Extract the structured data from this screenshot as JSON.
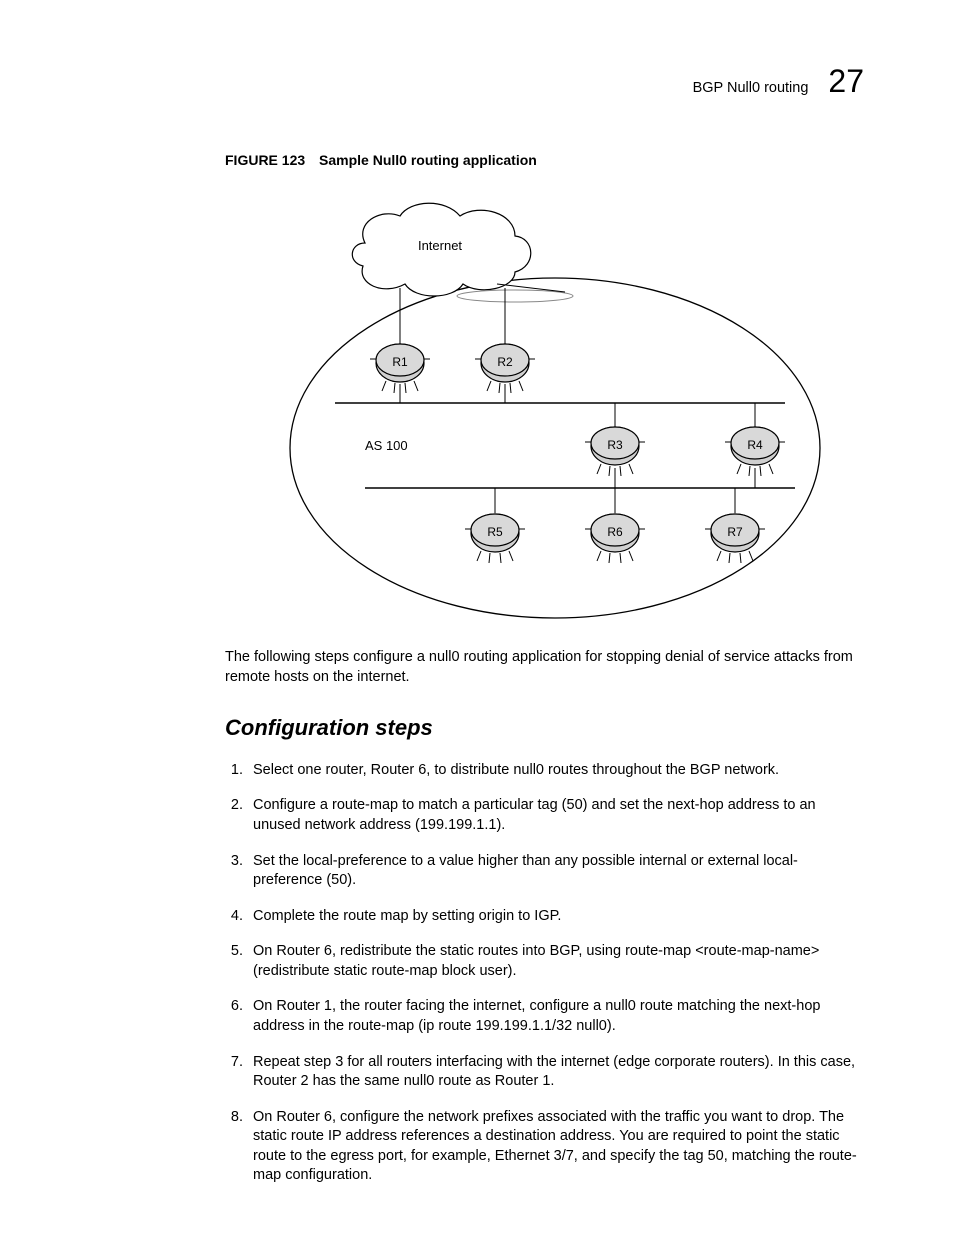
{
  "header": {
    "running_title": "BGP Null0 routing",
    "chapter_number": "27"
  },
  "figure": {
    "label": "FIGURE 123",
    "title": "Sample Null0 routing application",
    "cloud_label": "Internet",
    "as_label": "AS 100",
    "routers": {
      "r1": "R1",
      "r2": "R2",
      "r3": "R3",
      "r4": "R4",
      "r5": "R5",
      "r6": "R6",
      "r7": "R7"
    }
  },
  "intro": "The following steps configure a null0 routing application for stopping denial of service attacks from remote hosts on the internet.",
  "section_heading": "Configuration steps",
  "steps": [
    "Select one router, Router 6, to distribute null0 routes throughout the BGP network.",
    "Configure a route-map to match a particular tag (50) and set the next-hop address to an unused network address (199.199.1.1).",
    "Set the local-preference to a value higher than any possible internal or external local-preference (50).",
    "Complete the route map by setting origin to IGP.",
    "On Router 6, redistribute the static routes into BGP, using route-map <route-map-name> (redistribute static route-map block user).",
    "On Router 1, the router facing the internet, configure a null0 route matching the next-hop address in the route-map (ip route 199.199.1.1/32 null0).",
    "Repeat step 3 for all routers interfacing with the internet (edge corporate routers). In this case, Router 2 has the same null0 route as Router 1.",
    "On Router 6, configure the network prefixes associated with the traffic you want to drop. The static route IP address references a destination address. You are required to point the static route to the egress port, for example, Ethernet 3/7, and specify the tag 50, matching the route-map configuration."
  ]
}
